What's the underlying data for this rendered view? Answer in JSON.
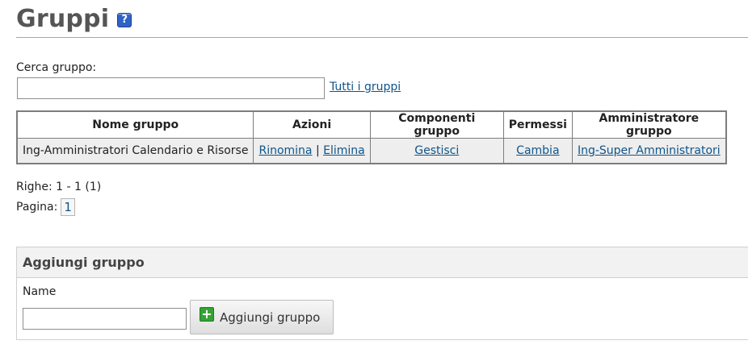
{
  "page": {
    "title": "Gruppi",
    "help_icon": "help-icon",
    "help_glyph": "?"
  },
  "search": {
    "label": "Cerca gruppo:",
    "value": "",
    "all_groups_link": "Tutti i gruppi"
  },
  "table": {
    "headers": {
      "name": "Nome gruppo",
      "actions": "Azioni",
      "members": "Componenti gruppo",
      "permissions": "Permessi",
      "admin": "Amministratore gruppo"
    },
    "rows": [
      {
        "name": "Ing-Amministratori Calendario e Risorse",
        "rename": "Rinomina",
        "separator": "|",
        "delete": "Elimina",
        "members": "Gestisci",
        "permissions": "Cambia",
        "admin": "Ing-Super Amministratori"
      }
    ]
  },
  "pagination": {
    "rows_info": "Righe: 1 - 1 (1)",
    "page_label": "Pagina:",
    "current_page": "1"
  },
  "add_group": {
    "header": "Aggiungi gruppo",
    "name_label": "Name",
    "name_value": "",
    "button_label": "Aggiungi gruppo",
    "button_icon": "plus-icon",
    "button_glyph": "+"
  },
  "colors": {
    "link": "#0f5489",
    "title": "#555555",
    "help_icon_bg": "#2f62c6",
    "plus_icon_bg": "#33a333",
    "row_bg": "#eeeeee"
  }
}
